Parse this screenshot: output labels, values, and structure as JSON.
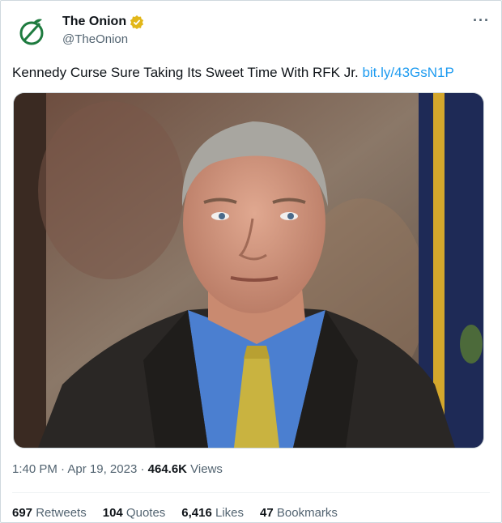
{
  "account": {
    "name": "The Onion",
    "handle": "@TheOnion"
  },
  "tweet": {
    "text": "Kennedy Curse Sure Taking Its Sweet Time With RFK Jr.",
    "link": "bit.ly/43GsN1P"
  },
  "meta": {
    "time": "1:40 PM",
    "sep1": " · ",
    "date": "Apr 19, 2023",
    "sep2": " · ",
    "views_count": "464.6K",
    "views_label": " Views"
  },
  "stats": {
    "retweets_count": "697",
    "retweets_label": " Retweets",
    "quotes_count": "104",
    "quotes_label": " Quotes",
    "likes_count": "6,416",
    "likes_label": " Likes",
    "bookmarks_count": "47",
    "bookmarks_label": " Bookmarks"
  },
  "icons": {
    "more": "···"
  },
  "colors": {
    "logo_green": "#1e7b3f",
    "verified_gold": "#e2b719",
    "link_blue": "#1d9bf0"
  }
}
